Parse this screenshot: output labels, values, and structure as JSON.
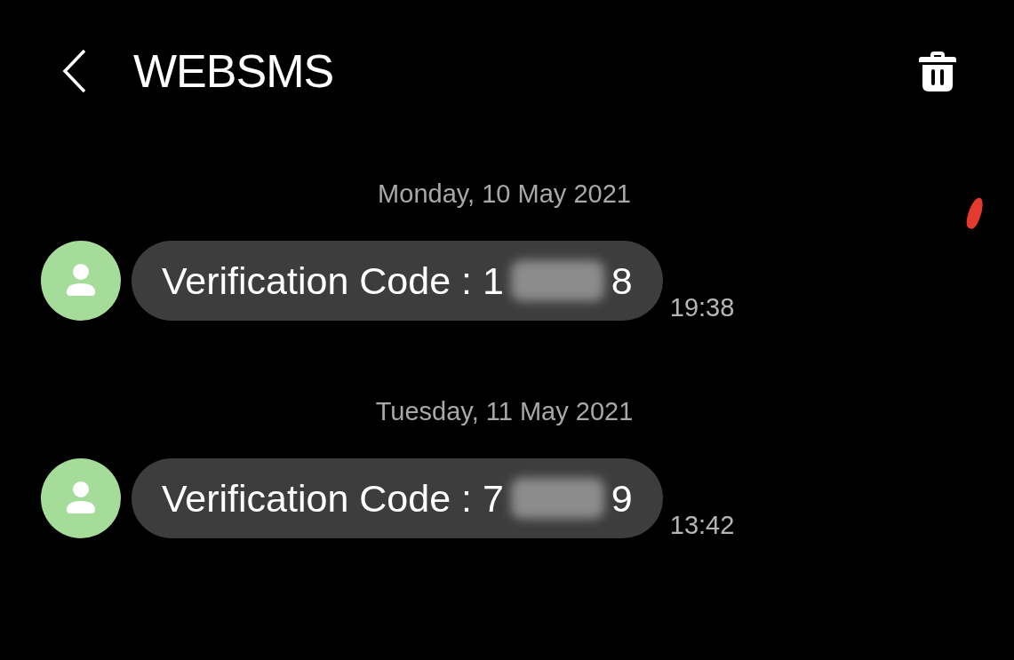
{
  "header": {
    "title": "WEBSMS"
  },
  "messages": [
    {
      "date": "Monday, 10 May 2021",
      "text_start": "Verification Code : 1",
      "redacted": true,
      "text_end": "8",
      "time": "19:38"
    },
    {
      "date": "Tuesday, 11 May 2021",
      "text_start": "Verification Code : 7",
      "redacted": true,
      "text_end": "9",
      "time": "13:42"
    }
  ]
}
